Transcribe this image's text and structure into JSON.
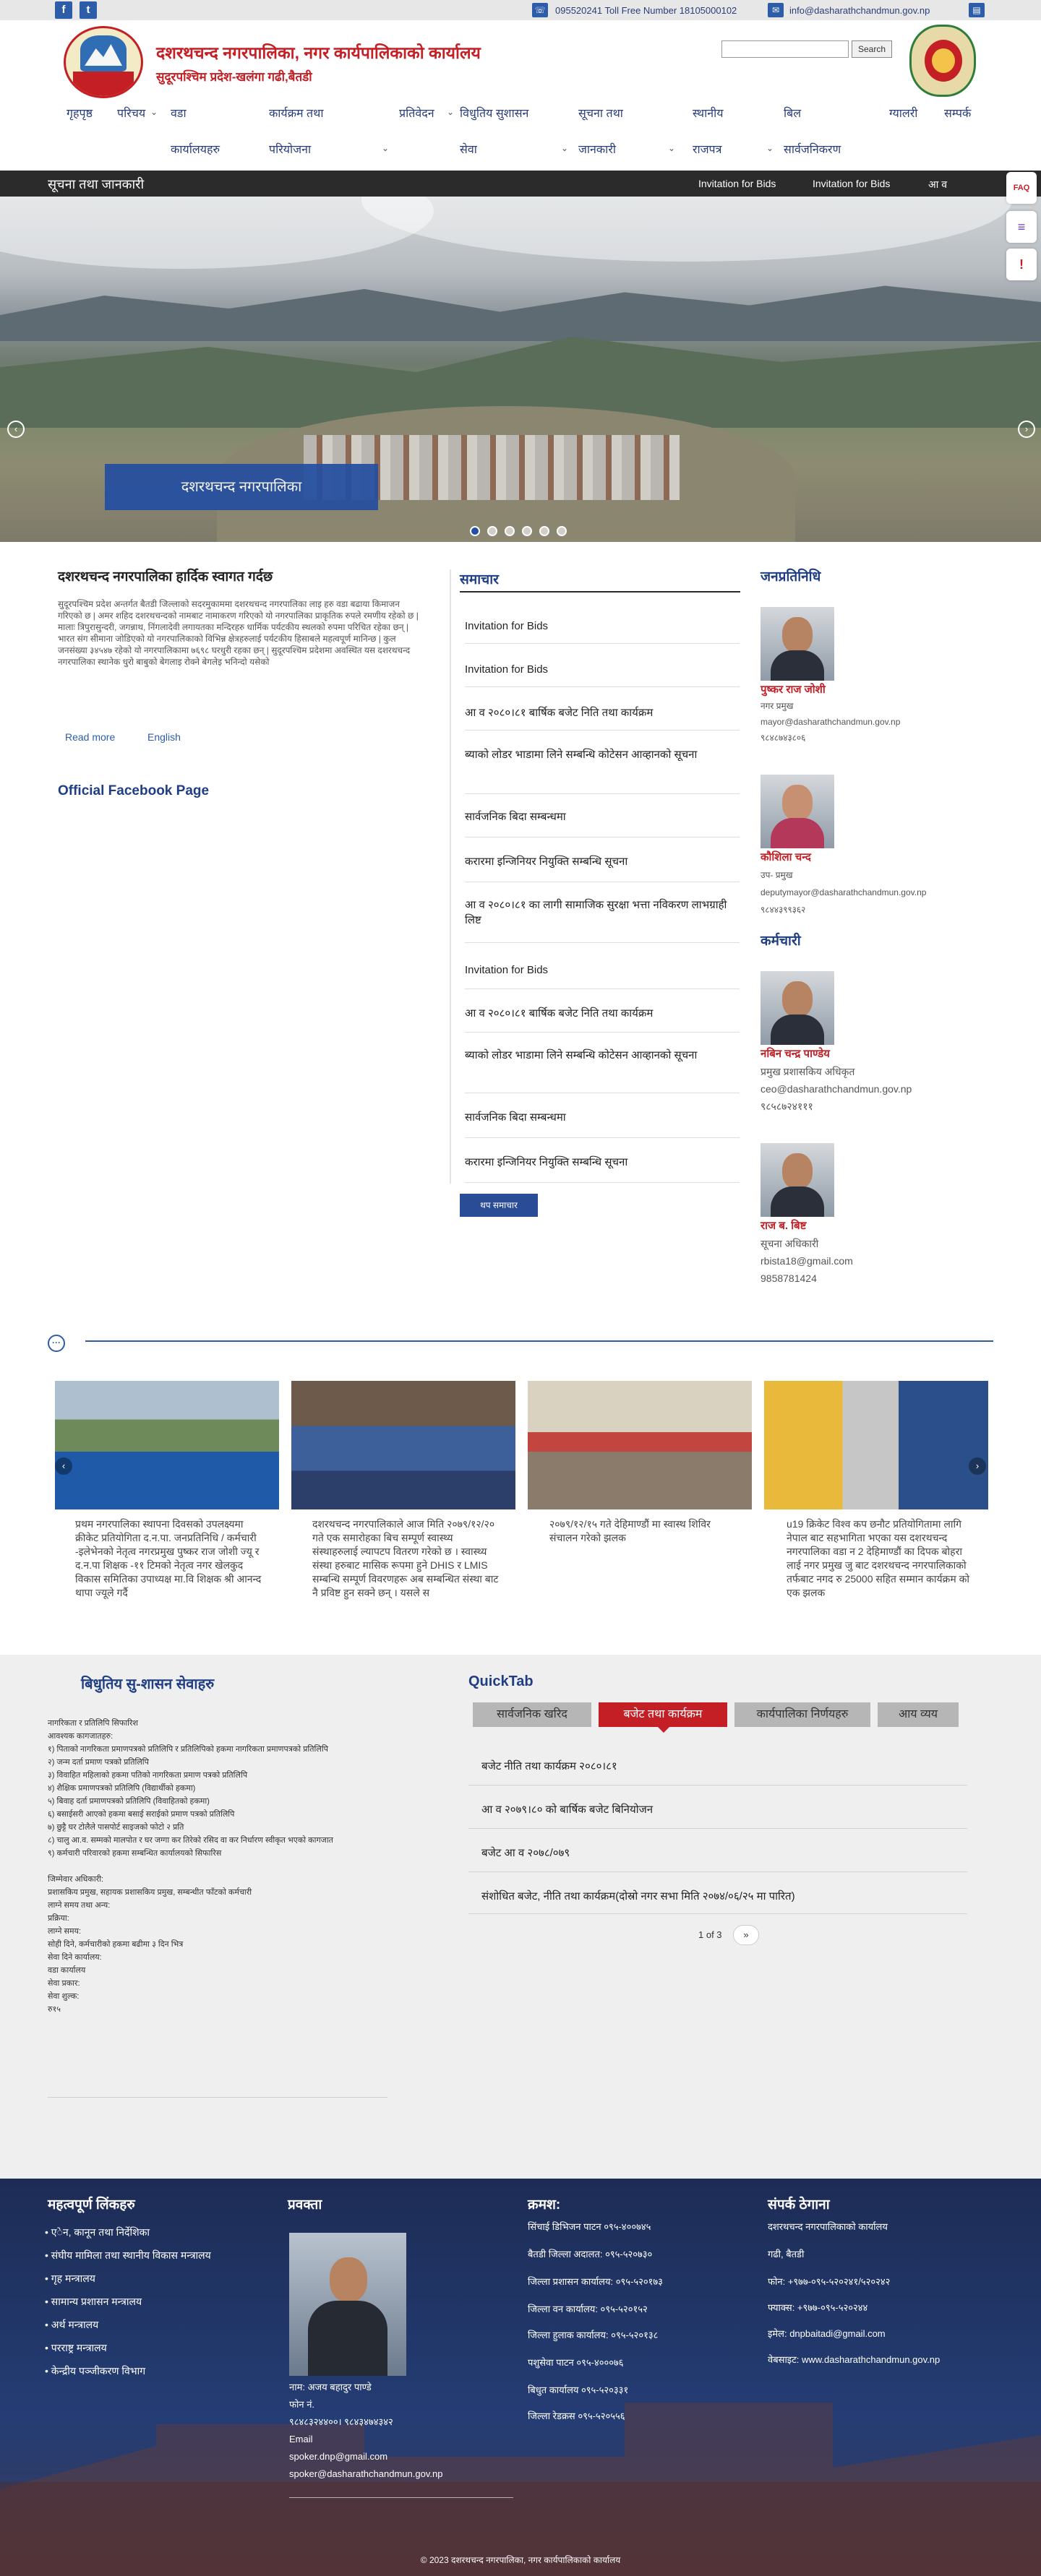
{
  "topbar": {
    "social": [
      "f",
      "t"
    ],
    "phone": "095520241 Toll Free Number 18105000102",
    "email": "info@dasharathchandmun.gov.np"
  },
  "header": {
    "title": "दशरथचन्द नगरपालिका, नगर कार्यपालिकाको कार्यालय",
    "subtitle": "सुदूरपश्चिम प्रदेश-खलंगा गढी,बैतडी",
    "search_button": "Search",
    "search_placeholder": ""
  },
  "nav": {
    "row1": [
      "गृहपृष्ठ",
      "परिचय",
      "वडा",
      "कार्यक्रम तथा",
      "प्रतिवेदन",
      "विधुतिय सुशासन",
      "सूचना तथा",
      "स्थानीय",
      "बिल",
      "ग्यालरी",
      "सम्पर्क"
    ],
    "row2": [
      "कार्यालयहरु",
      "परियोजना",
      "सेवा",
      "जानकारी",
      "राजपत्र",
      "सार्वजनिकरण"
    ]
  },
  "infobar": {
    "title": "सूचना तथा जानकारी",
    "ticker": [
      "Invitation for Bids",
      "Invitation for Bids",
      "आ व"
    ]
  },
  "slider": {
    "caption": "दशरथचन्द नगरपालिका"
  },
  "welcome": {
    "title": "दशरथचन्द नगरपालिका हार्दिक स्वागत गर्दछ",
    "text": "सुदूरपश्चिम प्रदेश अन्तर्गत बैतडी जिल्लाको सदरमुकाममा दशरथचन्द नगरपालिका लाइ हरु वडा बढाया किमाजन गरिएको छ | अमर शहिद दशरथचन्दको नामबाट नामाकरण गरिएको यो नगरपालिका प्राकृतिक रुपले रमणीय रहेको छ | मालाः त्रिपुरासुन्दरी, जगन्नाथ, निंगलादेवी लगायतका मन्दिरहरु धार्मिक पर्यटकीय स्थलको रुपमा परिचित रहेका छन् | भारत संग सीमाना जोडिएको यो नगरपालिकाको विभिन्न क्षेत्रहरुलाई पर्यटकीय हिसाबले महत्वपूर्ण मानिन्छ | कुल जनसंख्या ३४५४७ रहेको यो नगरपालिकामा ७६९८ घरधुरी रहका छन् | सुदूरपश्चिम प्रदेशमा अवस्थित यस दशरथचन्द नगरपालिका स्थानेक धुरो बाबुको बेगलाइ रोक्ने बेगलेइ भनिन्दो यसेको",
    "read_more": "Read more",
    "english": "English",
    "fb_title": "Official Facebook Page"
  },
  "news": {
    "title": "समाचार",
    "items": [
      "Invitation for Bids",
      "Invitation for Bids",
      "आ व २०८०।८१ बार्षिक बजेट निति तथा कार्यक्रम",
      "ब्याको लोडर भाडामा लिने सम्बन्धि कोटेसन आव्हानको सूचना",
      "सार्वजनिक बिदा सम्बन्धमा",
      "करारमा इन्जिनियर नियुक्ति सम्बन्धि सूचना",
      "आ व २०८०।८१ का लागी सामाजिक सुरक्षा भत्ता नविकरण लाभग्राही लिष्ट",
      "Invitation for Bids",
      "आ व २०८०।८१ बार्षिक बजेट निति तथा कार्यक्रम",
      "ब्याको लोडर भाडामा लिने सम्बन्धि कोटेसन आव्हानको सूचना",
      "सार्वजनिक बिदा सम्बन्धमा",
      "करारमा इन्जिनियर नियुक्ति सम्बन्धि सूचना"
    ],
    "more_button": "थप समाचार"
  },
  "officials": {
    "rep_title": "जनप्रतिनिधि",
    "staff_title": "कर्मचारी",
    "reps": [
      {
        "name": "पुष्कर राज जोशी",
        "role": "नगर प्रमुख",
        "email": "mayor@dasharathchandmun.gov.np",
        "phone": "९८४८७४३८०६"
      },
      {
        "name": "कौशिला चन्द",
        "role": "उप- प्रमुख",
        "email": "deputymayor@dasharathchandmun.gov.np",
        "phone": "९८४४३९९३६२"
      }
    ],
    "staff": [
      {
        "name": "नबिन चन्द्र पाण्डेय",
        "role": "प्रमुख प्रशासकिय अधिकृत",
        "email": "ceo@dasharathchandmun.gov.np",
        "phone": "९८५८७२४१११"
      },
      {
        "name": "राज ब. बिष्ट",
        "role": "सूचना अधिकारी",
        "email": "rbista18@gmail.com",
        "phone": "9858781424"
      }
    ]
  },
  "gallery": {
    "captions": [
      "प्रथम नगरपालिका स्थापना दिवसको उपलक्ष्यमा क्रीकेट प्रतियोगिता द.न.पा. जनप्रतिनिधि / कर्मचारी -इलेभेनको नेतृत्व नगरप्रमुख पुष्कर राज जोशी ज्यू र द.न.पा शिक्षक -११ टिमको नेतृत्व नगर खेलकुद विकास समितिका उपाध्यक्ष मा.वि शिक्षक श्री आनन्द थापा ज्यूले गर्दै",
      "दशरथचन्द नगरपालिकाले आज मिति २०७९/१२/२० गते एक समारोहका बिच सम्पूर्ण स्वास्थ्य संस्थाहरुलाई ल्यापटप वितरण गरेको छ । स्वास्थ्य संस्था हरुबाट मासिक रूपमा हुने DHIS र LMIS सम्बन्धि सम्पूर्ण विवरणहरू अब सम्बन्धित संस्था बाट नै प्रविष्ट हुन सक्ने छन् । यसले स",
      "२०७९/१२/१५ गते देहिमाण्डौं मा स्वास्थ शिविर संचालन गरेको झलक",
      "u19 क्रिकेट विश्व कप छनौट प्रतियोगितामा लागि नेपाल बाट सहभागिता भएका यस दशरथचन्द नगरपालिका वडा न 2 देहिमाण्डौं का दिपक बोहरा लाई नगर प्रमुख जु बाट दशरथचन्द नगरपालिकाको तर्फबाट नगद रु 25000 सहित सम्मान कार्यक्रम को एक झलक"
    ]
  },
  "governance": {
    "title": "बिधुतिय सु-शासन सेवाहरु",
    "body": "नागरिकता र प्रतिलिपि सिफारिश\nआवश्यक कागजातहरु:\n१) पिताको नागरिकता प्रमाणपत्रको प्रतिलिपि र प्रतिलिपिको हकमा नागरिकता प्रमाणपत्रको प्रतिलिपि\n२) जन्म दर्ता प्रमाण पत्रको प्रतिलिपि\n३) विवाहित महिलाको हकमा पतिको नागरिकता प्रमाण पत्रको प्रतिलिपि\n४) शैक्षिक प्रमाणपत्रको प्रतिलिपि (विद्यार्थीको हकमा)\n५) बिवाह दर्ता प्रमाणपत्रको प्रतिलिपि (विवाहितको हकमा)\n६) बसाईसरी आएको हकमा बसाई सराईको प्रमाण पत्रको प्रतिलिपि\n७) छुट्टै घर टोलैले पासपोर्ट साइजको फोटो २ प्रति\n८) चालु आ.व. सम्मको मालपोत र घर जग्गा कर तिरेको रसिद वा कर निर्धारण स्वीकृत भएको कागजात\n९) कर्मचारी परिवारको हकमा सम्बन्धित कार्यालयको सिफारिस\n\nजिम्मेवार अधिकारी:\nप्रशासकिय प्रमुख, सहायक प्रशासकिय प्रमुख, सम्बन्धीत फाँटको कर्मचारी\nलाग्ने समय तथा अन्य:\nप्रक्रिया:\nलाग्ने समय:\nसोही दिने, कर्मचारीको हकमा बढीमा ३ दिन भित्र\nसेवा दिने कार्यालय:\nवडा कार्यालय\nसेवा प्रकार:\nसेवा शुल्क:\nरु१५",
    "quicktab_title": "QuickTab",
    "tabs": [
      "सार्वजनिक खरिद",
      "बजेट तथा कार्यक्रम",
      "कार्यपालिका निर्णयहरु",
      "आय व्यय"
    ],
    "items": [
      "बजेट नीति तथा कार्यक्रम २०८०।८१",
      "आ व २०७९।८० को बार्षिक बजेट बिनियोजन",
      "बजेट आ व २०७८/०७९",
      "संशोधित बजेट, नीति तथा कार्यक्रम(दोस्रो नगर सभा मिति २०७४/०६/२५ मा पारित)"
    ],
    "page_info": "1 of 3",
    "next": "»"
  },
  "footer": {
    "links_title": "महत्वपूर्ण लिंकहरु",
    "links": [
      "एेन, कानून तथा निर्देशिका",
      "संघीय मामिला तथा स्थानीय विकास मन्त्रालय",
      "गृह मन्त्रालय",
      "सामान्य प्रशासन मन्त्रालय",
      "अर्थ मन्त्रालय",
      "परराष्ट्र मन्त्रालय",
      "केन्द्रीय पञ्जीकरण विभाग"
    ],
    "spokes_title": "प्रवक्ता",
    "spokes_lines": [
      "नाम: अजय बहादुर पाण्डे",
      "फोन नं.",
      "९८४८३२४४००। ९८४३४७४३४२",
      "Email",
      "spoker.dnp@gmail.com",
      "spoker@dasharathchandmun.gov.np"
    ],
    "index_title": "क्रमश:",
    "index_items": [
      "सिंचाई डिभिजन पाटन ०९५-४००७४५",
      "बैतडी जिल्ला अदालत: ०९५-५२०७३०",
      "जिल्ला प्रशासन कार्यालय: ०९५-५२०१७३",
      "जिल्ला वन कार्यालय: ०९५-५२०१५२",
      "जिल्ला हुलाक कार्यालय: ०९५-५२०१३८",
      "पशुसेवा पाटन ०९५-४०००७६",
      "बिधुत कार्यालय ०९५-५२०३३१",
      "जिल्ला रेडक्रस ०९५-५२०५५६"
    ],
    "contact_title": "संपर्क ठेगाना",
    "contact_lines": [
      "दशरथचन्द नगरपालिकाको कार्यालय",
      "गढी, बैतडी",
      "फोन: +९७७-०९५-५२०२४१/५२०२४२",
      "फ्याक्स: +९७७-०९५-५२०२४४",
      "इमेल: dnpbaitadi@gmail.com",
      "वेबसाइट: www.dasharathchandmun.gov.np"
    ],
    "copyright": "© 2023 दशरथचन्द नगरपालिका, नगर कार्यपालिकाको कार्यालय"
  },
  "float": [
    "FAQ",
    "≡",
    "!"
  ]
}
